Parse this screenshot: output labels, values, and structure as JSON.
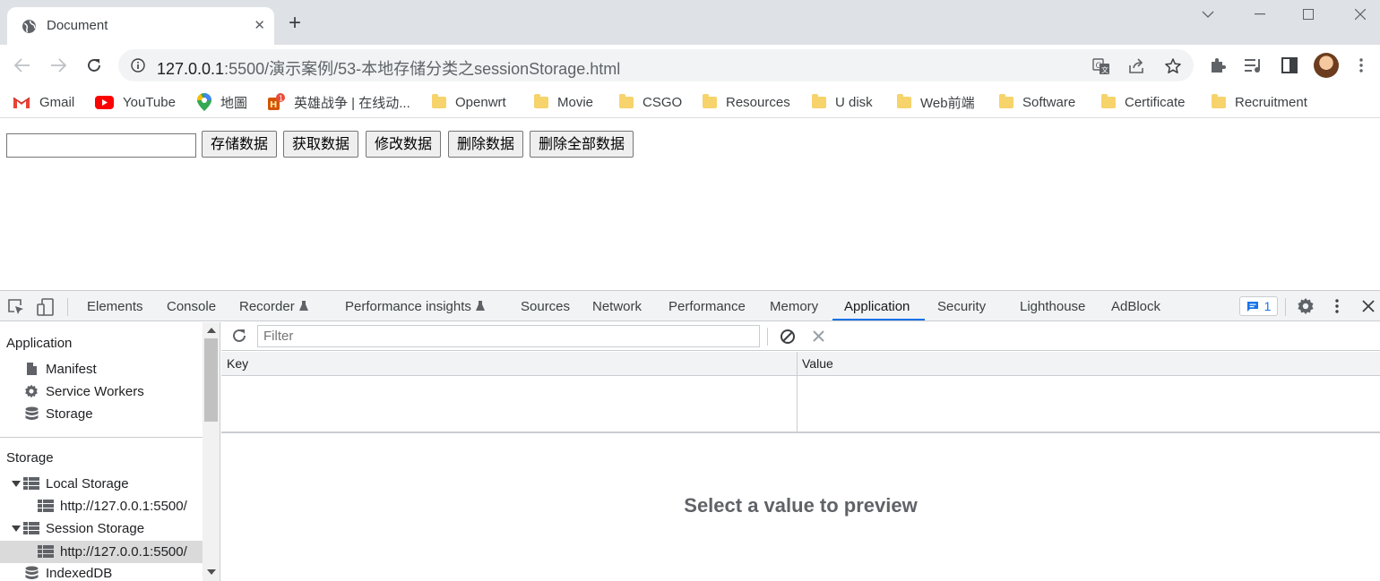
{
  "browser": {
    "tab_title": "Document",
    "url_host": "127.0.0.1",
    "url_rest": ":5500/演示案例/53-本地存储分类之sessionStorage.html"
  },
  "bookmarks": [
    {
      "label": "Gmail",
      "icon": "gmail-icon"
    },
    {
      "label": "YouTube",
      "icon": "youtube-icon"
    },
    {
      "label": "地圖",
      "icon": "maps-icon"
    },
    {
      "label": "英雄战争 | 在线动...",
      "icon": "game-icon"
    },
    {
      "label": "Openwrt",
      "icon": "folder-icon"
    },
    {
      "label": "Movie",
      "icon": "folder-icon"
    },
    {
      "label": "CSGO",
      "icon": "folder-icon"
    },
    {
      "label": "Resources",
      "icon": "folder-icon"
    },
    {
      "label": "U disk",
      "icon": "folder-icon"
    },
    {
      "label": "Web前端",
      "icon": "folder-icon"
    },
    {
      "label": "Software",
      "icon": "folder-icon"
    },
    {
      "label": "Certificate",
      "icon": "folder-icon"
    },
    {
      "label": "Recruitment",
      "icon": "folder-icon"
    }
  ],
  "page": {
    "input_value": "",
    "buttons": [
      "存储数据",
      "获取数据",
      "修改数据",
      "删除数据",
      "删除全部数据"
    ]
  },
  "devtools": {
    "tabs": [
      "Elements",
      "Console",
      "Recorder",
      "Performance insights",
      "Sources",
      "Network",
      "Performance",
      "Memory",
      "Application",
      "Security",
      "Lighthouse",
      "AdBlock"
    ],
    "active_tab": "Application",
    "issues_count": "1",
    "sidebar": {
      "application_header": "Application",
      "application_items": [
        "Manifest",
        "Service Workers",
        "Storage"
      ],
      "storage_header": "Storage",
      "local_storage": "Local Storage",
      "local_storage_origin": "http://127.0.0.1:5500/",
      "session_storage": "Session Storage",
      "session_storage_origin": "http://127.0.0.1:5500/",
      "indexeddb": "IndexedDB"
    },
    "filter_placeholder": "Filter",
    "columns": [
      "Key",
      "Value"
    ],
    "preview_text": "Select a value to preview"
  },
  "colors": {
    "accent": "#1a73e8",
    "tabstrip": "#dee1e6",
    "selected_row": "#dadada"
  }
}
